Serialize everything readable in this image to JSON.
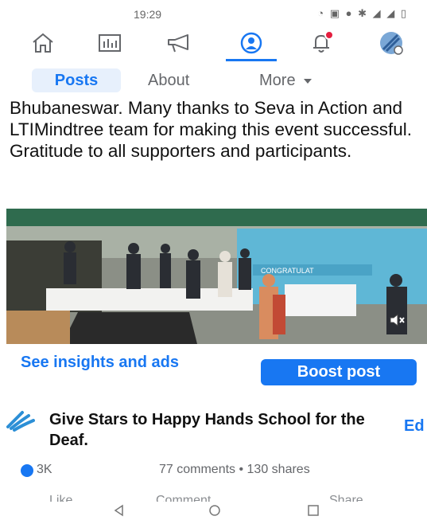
{
  "status_bar": {
    "time": "19:29",
    "icons_text": "◔ ▣ ● ✱ ◢ ◢ ▯"
  },
  "nav": {
    "items": [
      "home-icon",
      "pages-icon",
      "megaphone-icon",
      "profile-icon",
      "notifications-icon",
      "menu-avatar-icon"
    ],
    "active": "profile-icon",
    "accent": "#1877f2",
    "badge_color": "#e41e3f"
  },
  "tabs": {
    "posts": "Posts",
    "about": "About",
    "more": "More"
  },
  "post": {
    "text": "Bhubaneswar. Many thanks to Seva in Action and LTIMindtree team for making this event successful. Gratitude to all supporters and participants.",
    "photo_banner": "CONGRATULAT",
    "mute_icon": "speaker-muted-icon"
  },
  "insights_label": "See insights and ads",
  "boost_label": "Boost post",
  "shared": {
    "icon": "hands-icon",
    "title": "Give Stars to Happy Hands School for the Deaf.",
    "edit_label": "Ed"
  },
  "stats": {
    "reactions": "3K",
    "engagement": "77 comments • 130 shares"
  },
  "actions": {
    "like": "Like",
    "comment": "Comment",
    "share": "Share"
  },
  "system_nav": [
    "back-icon",
    "home-circle-icon",
    "recents-icon"
  ]
}
